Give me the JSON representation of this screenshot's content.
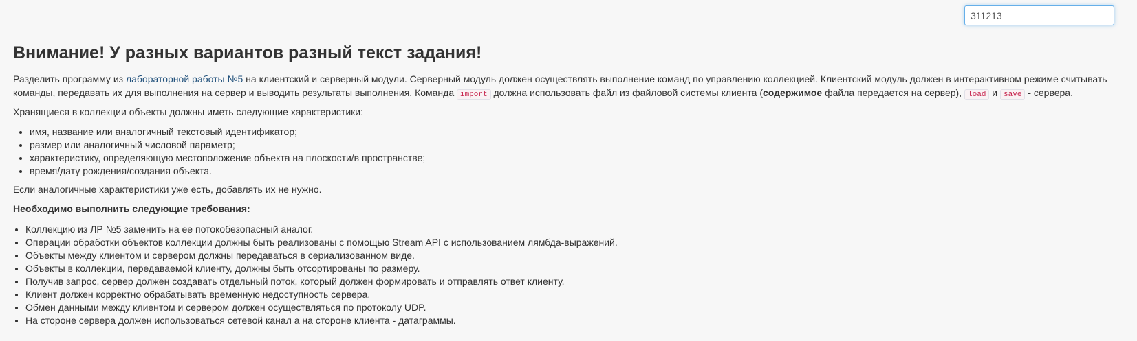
{
  "variant_input": {
    "value": "311213"
  },
  "heading": "Внимание! У разных вариантов разный текст задания!",
  "intro": {
    "part1": "Разделить программу из ",
    "link": "лабораторной работы №5",
    "part2": " на клиентский и серверный модули. Серверный модуль должен осуществлять выполнение команд по управлению коллекцией. Клиентский модуль должен в интерактивном режиме считывать",
    "part3": "команды, передавать их для выполнения на сервер и выводить результаты выполнения. Команда ",
    "code_import": "import",
    "part4": " должна использовать файл из файловой системы клиента (",
    "bold": "содержимое",
    "part5": " файла передается на сервер), ",
    "code_load": "load",
    "part6": " и ",
    "code_save": "save",
    "part7": " - сервера."
  },
  "characteristics_intro": "Хранящиеся в коллекции объекты должны иметь следующие характеристики:",
  "characteristics": [
    "имя, название или аналогичный текстовый идентификатор;",
    "размер или аналогичный числовой параметр;",
    "характеристику, определяющую местоположение объекта на плоскости/в пространстве;",
    "время/дату рождения/создания объекта."
  ],
  "if_same": "Если аналогичные характеристики уже есть, добавлять их не нужно.",
  "requirements_title": "Необходимо выполнить следующие требования:",
  "requirements": [
    "Коллекцию из ЛР №5 заменить на ее потокобезопасный аналог.",
    "Операции обработки объектов коллекции должны быть реализованы с помощью Stream API с использованием лямбда-выражений.",
    "Объекты между клиентом и сервером должны передаваться в сериализованном виде.",
    "Объекты в коллекции, передаваемой клиенту, должны быть отсортированы по размеру.",
    "Получив запрос, сервер должен создавать отдельный поток, который должен формировать и отправлять ответ клиенту.",
    "Клиент должен корректно обрабатывать временную недоступность сервера.",
    "Обмен данными между клиентом и сервером должен осуществляться по протоколу UDP.",
    "На стороне сервера должен использоваться сетевой канал а на стороне клиента - датаграммы."
  ]
}
